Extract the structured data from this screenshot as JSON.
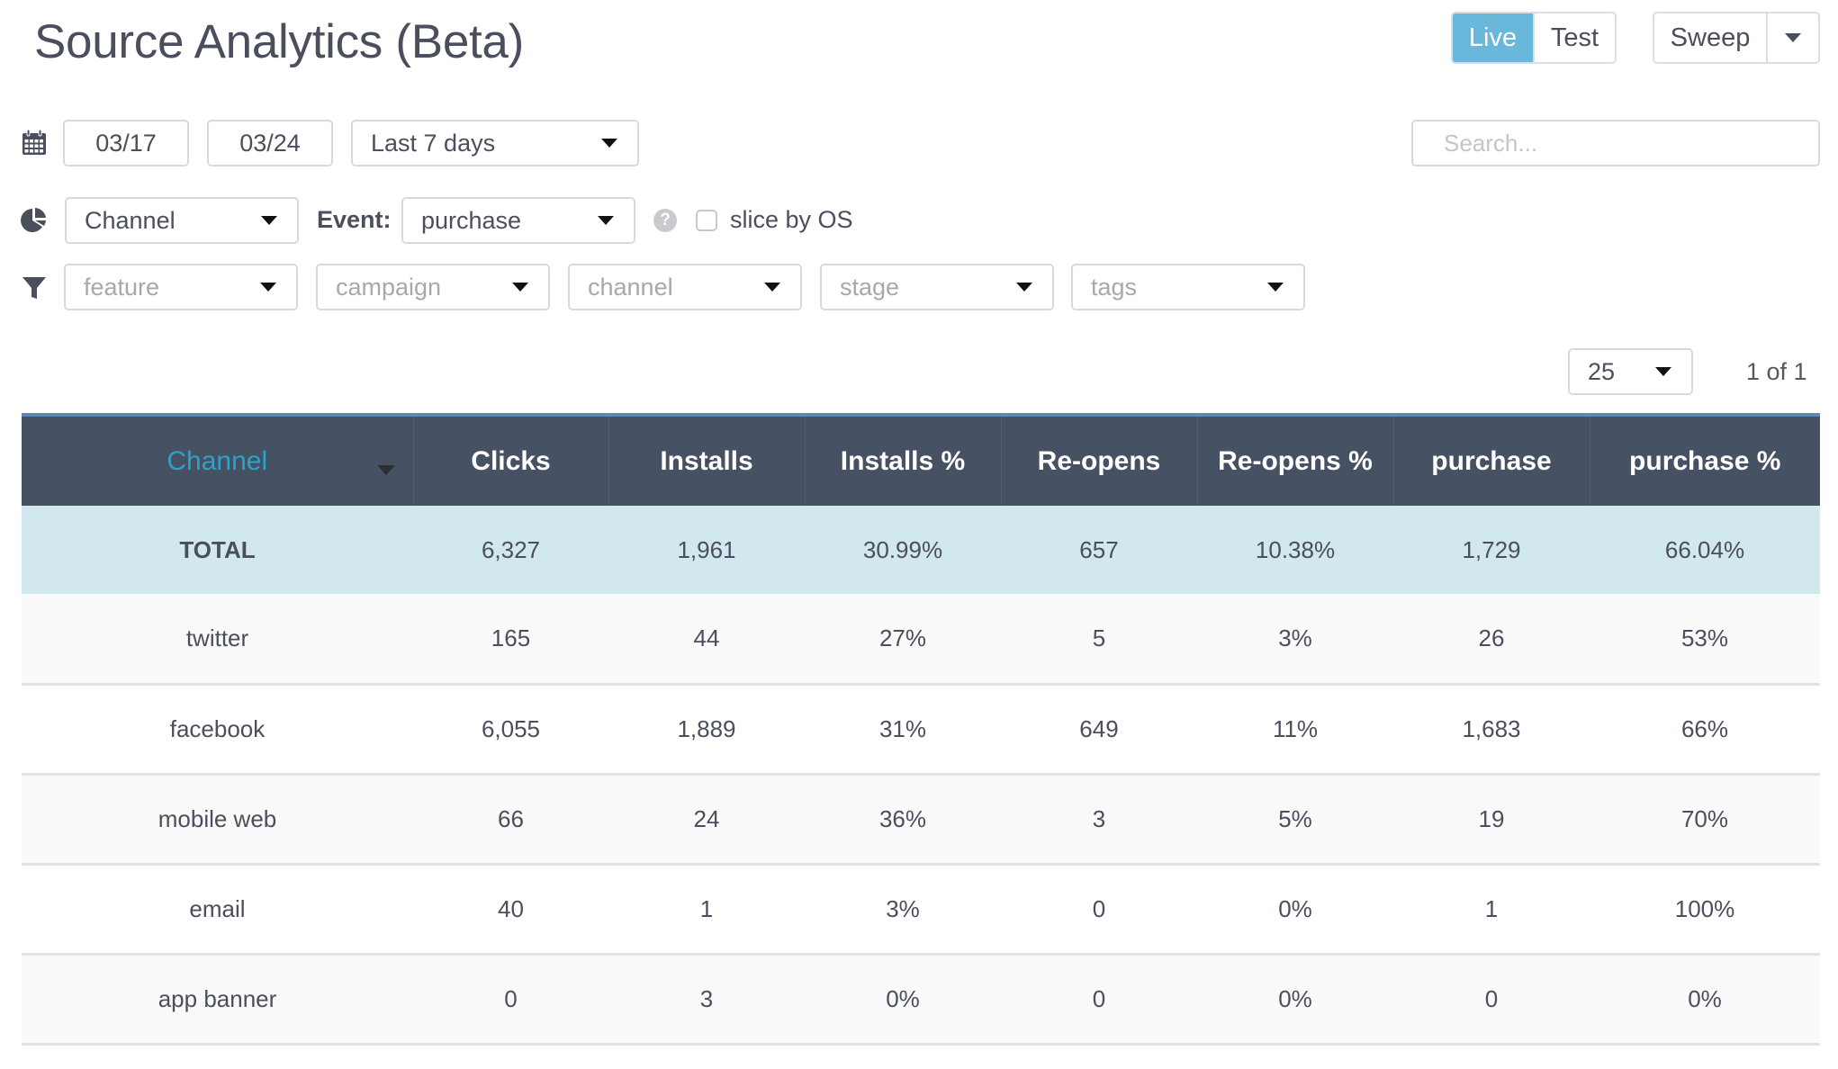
{
  "header": {
    "title": "Source Analytics (Beta)",
    "env_toggle": {
      "options": [
        "Live",
        "Test"
      ],
      "active": "Live"
    },
    "sweep": {
      "label": "Sweep"
    }
  },
  "date_row": {
    "icon": "calendar-icon",
    "start_date": "03/17",
    "end_date": "03/24",
    "range": "Last 7 days"
  },
  "search": {
    "placeholder": "Search...",
    "value": ""
  },
  "slice_row": {
    "icon": "pie-chart-icon",
    "group_by": "Channel",
    "event_label": "Event:",
    "event": "purchase",
    "help_icon": "question-circle-icon",
    "help_glyph": "?",
    "slice_by_os": {
      "label": "slice by OS",
      "checked": false
    }
  },
  "filter_row": {
    "icon": "filter-icon",
    "filters": [
      {
        "placeholder": "feature"
      },
      {
        "placeholder": "campaign"
      },
      {
        "placeholder": "channel"
      },
      {
        "placeholder": "stage"
      },
      {
        "placeholder": "tags"
      }
    ]
  },
  "pagination": {
    "per_page": "25",
    "page_info": "1 of 1"
  },
  "table": {
    "columns": [
      "Channel",
      "Clicks",
      "Installs",
      "Installs %",
      "Re-opens",
      "Re-opens %",
      "purchase",
      "purchase %"
    ],
    "sorted_column": "Channel",
    "total": [
      "TOTAL",
      "6,327",
      "1,961",
      "30.99%",
      "657",
      "10.38%",
      "1,729",
      "66.04%"
    ],
    "rows": [
      [
        "twitter",
        "165",
        "44",
        "27%",
        "5",
        "3%",
        "26",
        "53%"
      ],
      [
        "facebook",
        "6,055",
        "1,889",
        "31%",
        "649",
        "11%",
        "1,683",
        "66%"
      ],
      [
        "mobile web",
        "66",
        "24",
        "36%",
        "3",
        "5%",
        "19",
        "70%"
      ],
      [
        "email",
        "40",
        "1",
        "3%",
        "0",
        "0%",
        "1",
        "100%"
      ],
      [
        "app banner",
        "0",
        "3",
        "0%",
        "0",
        "0%",
        "0",
        "0%"
      ]
    ]
  },
  "colors": {
    "accent": "#69b7da",
    "header_bg": "#465163",
    "header_border": "#5e86b8",
    "sorted_header_text": "#2aa4c4",
    "total_row_bg": "#d1e9ee"
  }
}
